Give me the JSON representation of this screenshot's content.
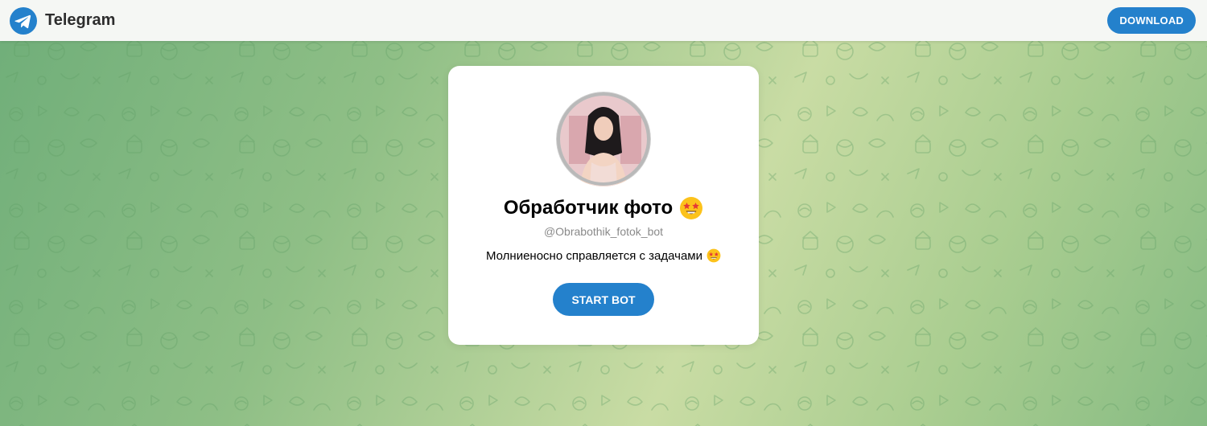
{
  "header": {
    "brand_name": "Telegram",
    "brand_icon": "telegram-logo-icon",
    "download_label": "DOWNLOAD"
  },
  "bot": {
    "title": "Обработчик фото",
    "title_emoji": "star-struck-emoji-icon",
    "username": "@Obrabothik_fotok_bot",
    "description": "Молниеносно справляется с задачами",
    "description_emoji": "star-struck-emoji-icon",
    "start_label": "START BOT"
  },
  "colors": {
    "accent": "#2481cc",
    "header_bg": "#f5f7f4",
    "card_bg": "#ffffff",
    "username_color": "#8a8a8a"
  }
}
